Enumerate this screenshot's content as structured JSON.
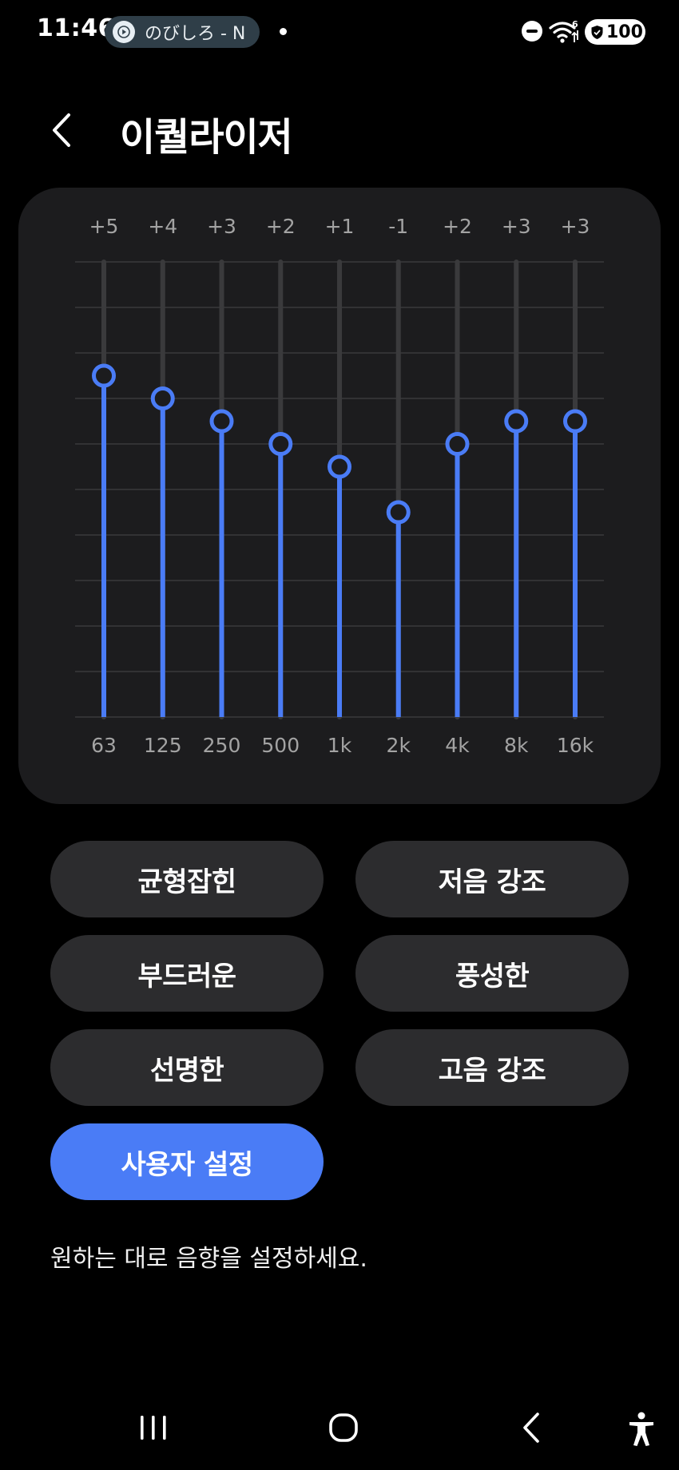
{
  "status_bar": {
    "time": "11:46",
    "media_title": "のびしろ - N",
    "battery": "100"
  },
  "header": {
    "title": "이퀄라이저"
  },
  "equalizer": {
    "unit_hint": "dB",
    "bands": [
      {
        "freq": "63",
        "gain_label": "+5",
        "gain": 5
      },
      {
        "freq": "125",
        "gain_label": "+4",
        "gain": 4
      },
      {
        "freq": "250",
        "gain_label": "+3",
        "gain": 3
      },
      {
        "freq": "500",
        "gain_label": "+2",
        "gain": 2
      },
      {
        "freq": "1k",
        "gain_label": "+1",
        "gain": 1
      },
      {
        "freq": "2k",
        "gain_label": "-1",
        "gain": -1
      },
      {
        "freq": "4k",
        "gain_label": "+2",
        "gain": 2
      },
      {
        "freq": "8k",
        "gain_label": "+3",
        "gain": 3
      },
      {
        "freq": "16k",
        "gain_label": "+3",
        "gain": 3
      }
    ],
    "range": [
      -10,
      10
    ],
    "colors": {
      "active": "#4a7cf6",
      "track": "#3a3a3c",
      "grid": "#3a3a3c",
      "knob_fill": "#1c1c1e"
    }
  },
  "presets": {
    "balanced": "균형잡힌",
    "bass_boost": "저음 강조",
    "soft": "부드러운",
    "dynamic": "풍성한",
    "clear": "선명한",
    "treble_boost": "고음 강조",
    "custom": "사용자 설정",
    "selected": "custom"
  },
  "hint_text": "원하는 대로 음향을 설정하세요."
}
